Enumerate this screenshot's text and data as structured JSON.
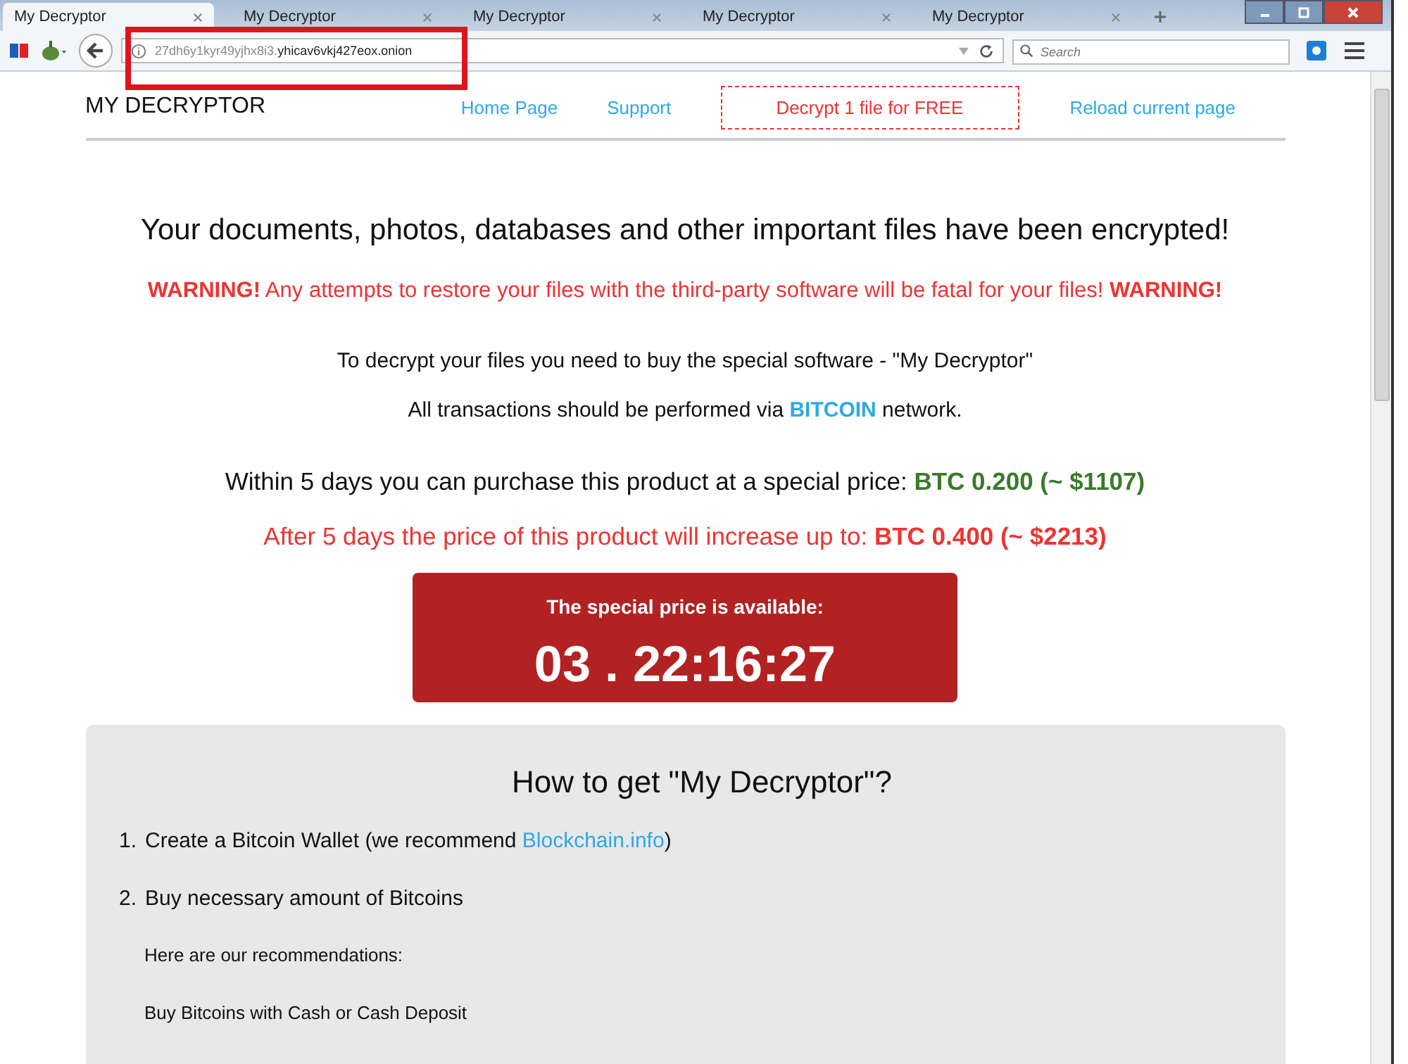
{
  "tabs": [
    {
      "label": "My Decryptor",
      "selected": true
    },
    {
      "label": "My Decryptor",
      "selected": false
    },
    {
      "label": "My Decryptor",
      "selected": false
    },
    {
      "label": "My Decryptor",
      "selected": false
    },
    {
      "label": "My Decryptor",
      "selected": false
    }
  ],
  "address": {
    "subdomain": "27dh6y1kyr49yjhx8i3.",
    "domain": "yhicav6vkj427eox.onion"
  },
  "search": {
    "placeholder": "Search"
  },
  "site": {
    "logo": "MY DECRYPTOR",
    "nav": [
      {
        "label": "Home Page",
        "kind": "link"
      },
      {
        "label": "Support",
        "kind": "link"
      },
      {
        "label": "Decrypt 1 file for FREE",
        "kind": "boxed"
      },
      {
        "label": "Reload current page",
        "kind": "link"
      }
    ]
  },
  "headline": "Your documents, photos, databases and other important files have been encrypted!",
  "warning": [
    {
      "text": "WARNING!",
      "kind": "strong"
    },
    {
      "text": " Any attempts to restore your files with the third-party software will be fatal for your files! ",
      "kind": "plain"
    },
    {
      "text": "WARNING!",
      "kind": "strong"
    }
  ],
  "info": [
    [
      {
        "text": "To decrypt your files you need to buy the special software - \"My Decryptor\"",
        "kind": "plain"
      }
    ],
    [
      {
        "text": "All transactions should be performed via ",
        "kind": "plain"
      },
      {
        "text": "BITCOIN",
        "kind": "accent"
      },
      {
        "text": " network.",
        "kind": "plain"
      }
    ]
  ],
  "prices": [
    {
      "kind": "special",
      "parts": [
        {
          "text": "Within 5 days you can purchase this product at a special price: ",
          "kind": "plain"
        },
        {
          "text": "BTC 0.200 (~ $1107)",
          "kind": "strong"
        }
      ]
    },
    {
      "kind": "later",
      "parts": [
        {
          "text": "After 5 days the price of this product will increase up to: ",
          "kind": "plain"
        },
        {
          "text": "BTC 0.400 (~ $2213)",
          "kind": "strong"
        }
      ]
    }
  ],
  "countdown": {
    "title": "The special price is available:",
    "time": "03 . 22:16:27"
  },
  "howto": {
    "title": "How to get \"My Decryptor\"?",
    "steps": [
      {
        "number": "1.",
        "parts": [
          {
            "text": "Create a Bitcoin Wallet (we recommend ",
            "kind": "plain"
          },
          {
            "text": "Blockchain.info",
            "kind": "link"
          },
          {
            "text": ")",
            "kind": "plain"
          }
        ]
      },
      {
        "number": "2.",
        "parts": [
          {
            "text": "Buy necessary amount of Bitcoins",
            "kind": "plain"
          }
        ]
      }
    ],
    "notes": [
      "Here are our recommendations:",
      "Buy Bitcoins with Cash or Cash Deposit"
    ]
  }
}
